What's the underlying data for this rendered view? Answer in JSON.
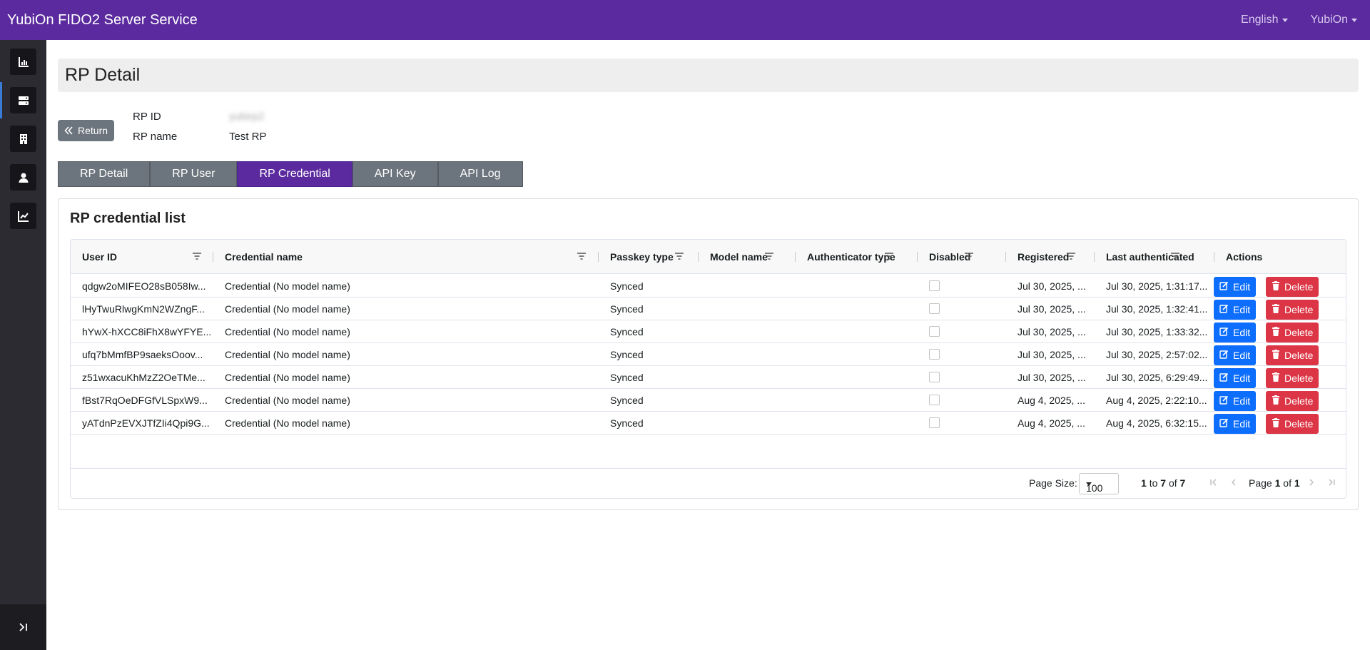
{
  "app": {
    "title": "YubiOn FIDO2 Server Service"
  },
  "topnav": {
    "language": "English",
    "user": "YubiOn"
  },
  "sidebar": {
    "items": [
      "dashboard-icon",
      "server-icon",
      "building-icon",
      "user-icon",
      "line-chart-icon"
    ],
    "collapse": "collapse-sidebar-icon"
  },
  "page": {
    "title": "RP Detail"
  },
  "return_label": "Return",
  "rp": {
    "id_label": "RP ID",
    "id_value": "yubirp2",
    "name_label": "RP name",
    "name_value": "Test RP"
  },
  "tabs": [
    {
      "label": "RP Detail",
      "active": false
    },
    {
      "label": "RP User",
      "active": false
    },
    {
      "label": "RP Credential",
      "active": true
    },
    {
      "label": "API Key",
      "active": false
    },
    {
      "label": "API Log",
      "active": false
    }
  ],
  "card": {
    "title": "RP credential list"
  },
  "table": {
    "columns": [
      "User ID",
      "Credential name",
      "Passkey type",
      "Model name",
      "Authenticator type",
      "Disabled",
      "Registered",
      "Last authenticated",
      "Actions"
    ],
    "rows": [
      {
        "user_id": "qdgw2oMIFEO28sB058Iw...",
        "credential_name": "Credential (No model name)",
        "passkey_type": "Synced",
        "model_name": "",
        "authenticator_type": "",
        "disabled": false,
        "registered": "Jul 30, 2025, ...",
        "last_authenticated": "Jul 30, 2025, 1:31:17..."
      },
      {
        "user_id": "lHyTwuRlwgKmN2WZngF...",
        "credential_name": "Credential (No model name)",
        "passkey_type": "Synced",
        "model_name": "",
        "authenticator_type": "",
        "disabled": false,
        "registered": "Jul 30, 2025, ...",
        "last_authenticated": "Jul 30, 2025, 1:32:41..."
      },
      {
        "user_id": "hYwX-hXCC8iFhX8wYFYE...",
        "credential_name": "Credential (No model name)",
        "passkey_type": "Synced",
        "model_name": "",
        "authenticator_type": "",
        "disabled": false,
        "registered": "Jul 30, 2025, ...",
        "last_authenticated": "Jul 30, 2025, 1:33:32..."
      },
      {
        "user_id": "ufq7bMmfBP9saeksOoov...",
        "credential_name": "Credential (No model name)",
        "passkey_type": "Synced",
        "model_name": "",
        "authenticator_type": "",
        "disabled": false,
        "registered": "Jul 30, 2025, ...",
        "last_authenticated": "Jul 30, 2025, 2:57:02..."
      },
      {
        "user_id": "z51wxacuKhMzZ2OeTMe...",
        "credential_name": "Credential (No model name)",
        "passkey_type": "Synced",
        "model_name": "",
        "authenticator_type": "",
        "disabled": false,
        "registered": "Jul 30, 2025, ...",
        "last_authenticated": "Jul 30, 2025, 6:29:49..."
      },
      {
        "user_id": "fBst7RqOeDFGfVLSpxW9...",
        "credential_name": "Credential (No model name)",
        "passkey_type": "Synced",
        "model_name": "",
        "authenticator_type": "",
        "disabled": false,
        "registered": "Aug 4, 2025, ...",
        "last_authenticated": "Aug 4, 2025, 2:22:10..."
      },
      {
        "user_id": "yATdnPzEVXJTfZIi4Qpi9G...",
        "credential_name": "Credential (No model name)",
        "passkey_type": "Synced",
        "model_name": "",
        "authenticator_type": "",
        "disabled": false,
        "registered": "Aug 4, 2025, ...",
        "last_authenticated": "Aug 4, 2025, 6:32:15..."
      }
    ],
    "edit_label": "Edit",
    "delete_label": "Delete"
  },
  "pagination": {
    "page_size_label": "Page Size:",
    "page_size_value": "100",
    "range_from": "1",
    "range_to_word": "to",
    "range_to": "7",
    "range_of_word": "of",
    "range_total": "7",
    "page_word": "Page",
    "page_current": "1",
    "page_of_word": "of",
    "page_total": "1"
  },
  "colors": {
    "navbar": "#5a2a9e",
    "sidebar": "#2b2b31",
    "tab": "#6c757d",
    "tab_active": "#5a2a9e",
    "edit": "#0d6efd",
    "delete": "#dc3545"
  }
}
